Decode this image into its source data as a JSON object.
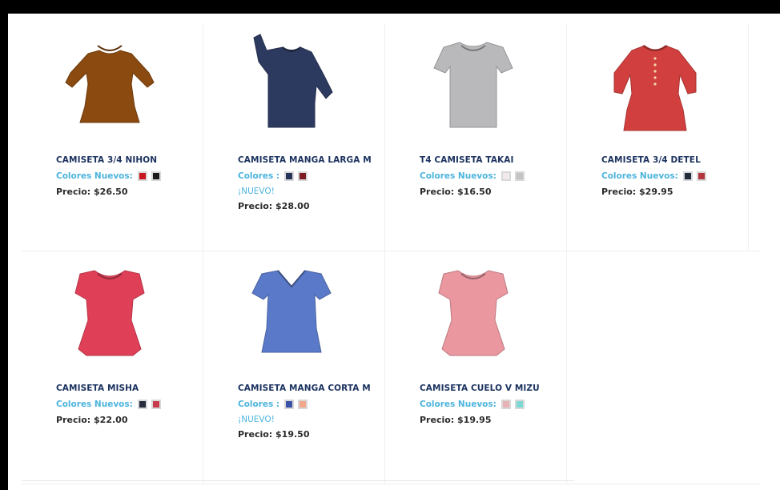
{
  "products": [
    {
      "name": "CAMISETA 3/4 NIHON",
      "colors_label": "Colores Nuevos:",
      "swatches": [
        "#c8151f",
        "#1b1b1b"
      ],
      "nuevo": "",
      "price": "Precio: $26.50",
      "garment": {
        "type": "longsleeve",
        "color": "#8a4a10"
      }
    },
    {
      "name": "CAMISETA MANGA LARGA M",
      "colors_label": "Colores :",
      "swatches": [
        "#27345a",
        "#7e1a22"
      ],
      "nuevo": "¡NUEVO!",
      "price": "Precio: $28.00",
      "garment": {
        "type": "longsleeve-raised",
        "color": "#2d3a60"
      }
    },
    {
      "name": "T4 CAMISETA TAKAI",
      "colors_label": "Colores Nuevos:",
      "swatches": [
        "#f1e9ee",
        "#c3c3c3"
      ],
      "nuevo": "",
      "price": "Precio: $16.50",
      "garment": {
        "type": "tee",
        "color": "#b9b9bc"
      }
    },
    {
      "name": "CAMISETA 3/4 DETEL",
      "colors_label": "Colores Nuevos:",
      "swatches": [
        "#252a3d",
        "#b3363f"
      ],
      "nuevo": "",
      "price": "Precio: $29.95",
      "garment": {
        "type": "longsleeve-buttons",
        "color": "#d1403f"
      }
    },
    {
      "name": "CAMISETA MISHA",
      "colors_label": "Colores Nuevos:",
      "swatches": [
        "#262b3d",
        "#c83b4c"
      ],
      "nuevo": "",
      "price": "Precio: $22.00",
      "garment": {
        "type": "capsleeve",
        "color": "#e04057"
      }
    },
    {
      "name": "CAMISETA MANGA CORTA M",
      "colors_label": "Colores :",
      "swatches": [
        "#3a52a8",
        "#f2a68a"
      ],
      "nuevo": "¡NUEVO!",
      "price": "Precio: $19.50",
      "garment": {
        "type": "vneck",
        "color": "#5a79c8"
      }
    },
    {
      "name": "CAMISETA CUELO V MIZU",
      "colors_label": "Colores Nuevos:",
      "swatches": [
        "#e6b3b6",
        "#7ed9d4"
      ],
      "nuevo": "",
      "price": "Precio: $19.95",
      "garment": {
        "type": "capsleeve",
        "color": "#ea97a0"
      }
    }
  ]
}
